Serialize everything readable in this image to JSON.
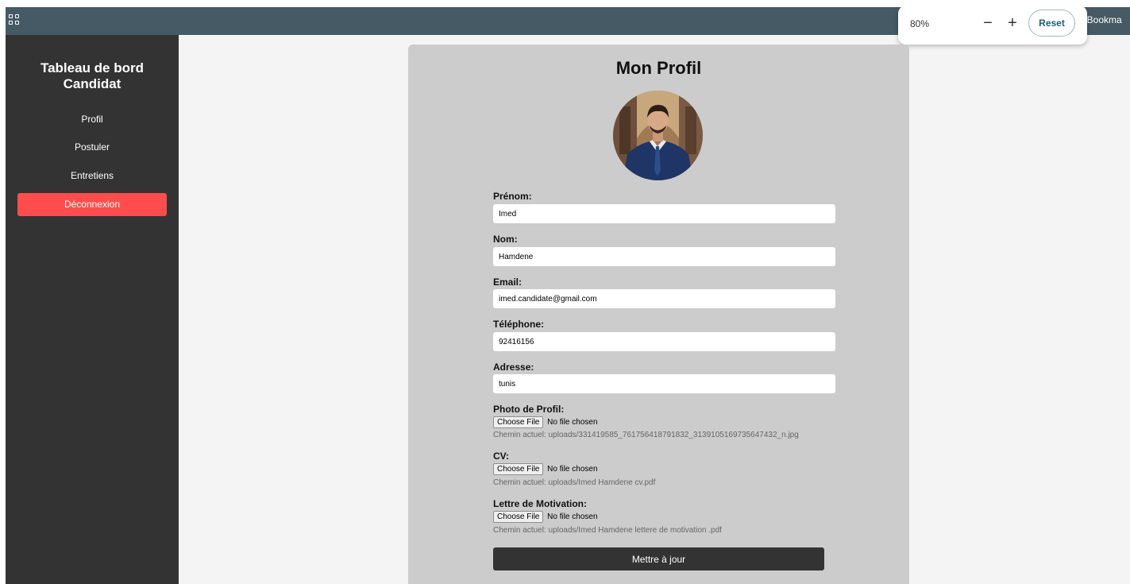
{
  "browser": {
    "zoom_level": "80%",
    "zoom_out_symbol": "−",
    "zoom_in_symbol": "+",
    "reset_label": "Reset",
    "bookmarks_label": "ll Bookma"
  },
  "sidebar": {
    "title_line1": "Tableau de bord",
    "title_line2": "Candidat",
    "items": [
      {
        "label": "Profil"
      },
      {
        "label": "Postuler"
      },
      {
        "label": "Entretiens"
      },
      {
        "label": "Déconnexion"
      }
    ]
  },
  "profile": {
    "title": "Mon Profil",
    "fields": [
      {
        "label": "Prénom:",
        "value": "Imed"
      },
      {
        "label": "Nom:",
        "value": "Hamdene"
      },
      {
        "label": "Email:",
        "value": "imed.candidate@gmail.com"
      },
      {
        "label": "Téléphone:",
        "value": "92416156"
      },
      {
        "label": "Adresse:",
        "value": "tunis"
      }
    ],
    "files": [
      {
        "label": "Photo de Profil:",
        "button": "Choose File",
        "status": "No file chosen",
        "current": "Chemin actuel: uploads/331419585_761756418791832_3139105169735647432_n.jpg"
      },
      {
        "label": "CV:",
        "button": "Choose File",
        "status": "No file chosen",
        "current": "Chemin actuel: uploads/Imed Hamdene cv.pdf"
      },
      {
        "label": "Lettre de Motivation:",
        "button": "Choose File",
        "status": "No file chosen",
        "current": "Chemin actuel: uploads/Imed Hamdene lettere de motivation .pdf"
      }
    ],
    "submit_label": "Mettre à jour"
  },
  "colors": {
    "sidebar_bg": "#333333",
    "logout_bg": "#ff4d4d",
    "topbar_bg": "#455a64",
    "card_bg": "#cccccc",
    "submit_bg": "#333333"
  }
}
